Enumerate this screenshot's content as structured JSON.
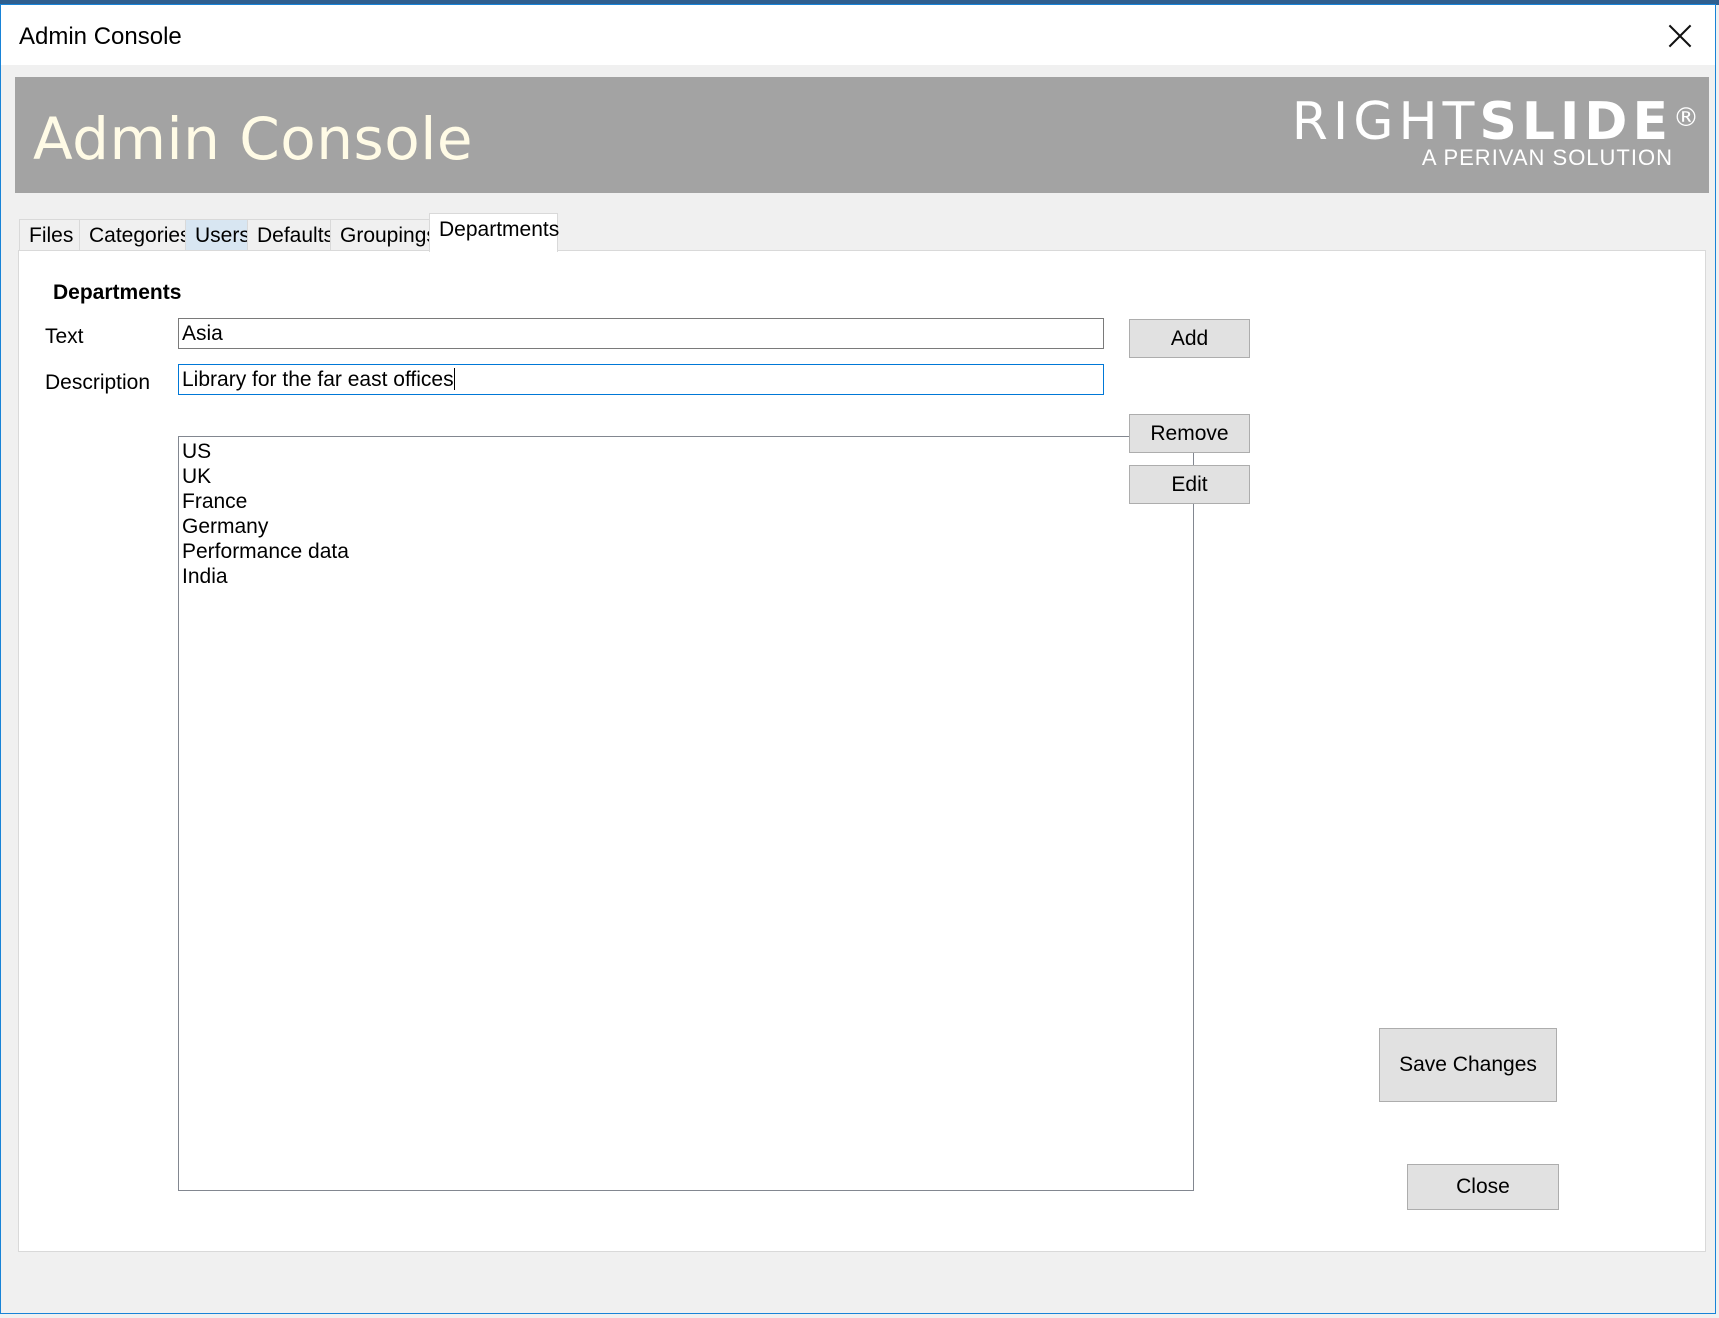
{
  "window": {
    "title": "Admin Console"
  },
  "banner": {
    "heading": "Admin Console",
    "logo": {
      "light": "RIGHT",
      "bold": "SLIDE",
      "mark": "®",
      "tagline": "A PERIVAN SOLUTION"
    }
  },
  "tabs": [
    {
      "label": "Files"
    },
    {
      "label": "Categories"
    },
    {
      "label": "Users"
    },
    {
      "label": "Defaults"
    },
    {
      "label": "Groupings"
    },
    {
      "label": "Departments"
    }
  ],
  "active_tab": "Departments",
  "departments": {
    "section_title": "Departments",
    "text_label": "Text",
    "text_value": "Asia",
    "description_label": "Description",
    "description_value": "Library for the far east offices",
    "items": [
      "US",
      "UK",
      "France",
      "Germany",
      "Performance data",
      "India"
    ],
    "buttons": {
      "add": "Add",
      "remove": "Remove",
      "edit": "Edit",
      "save": "Save Changes"
    }
  },
  "footer": {
    "close_label": "Close"
  },
  "colors": {
    "banner_bg": "#a3a3a3",
    "heading": "#fffbe6",
    "focus_border": "#0078d7"
  }
}
